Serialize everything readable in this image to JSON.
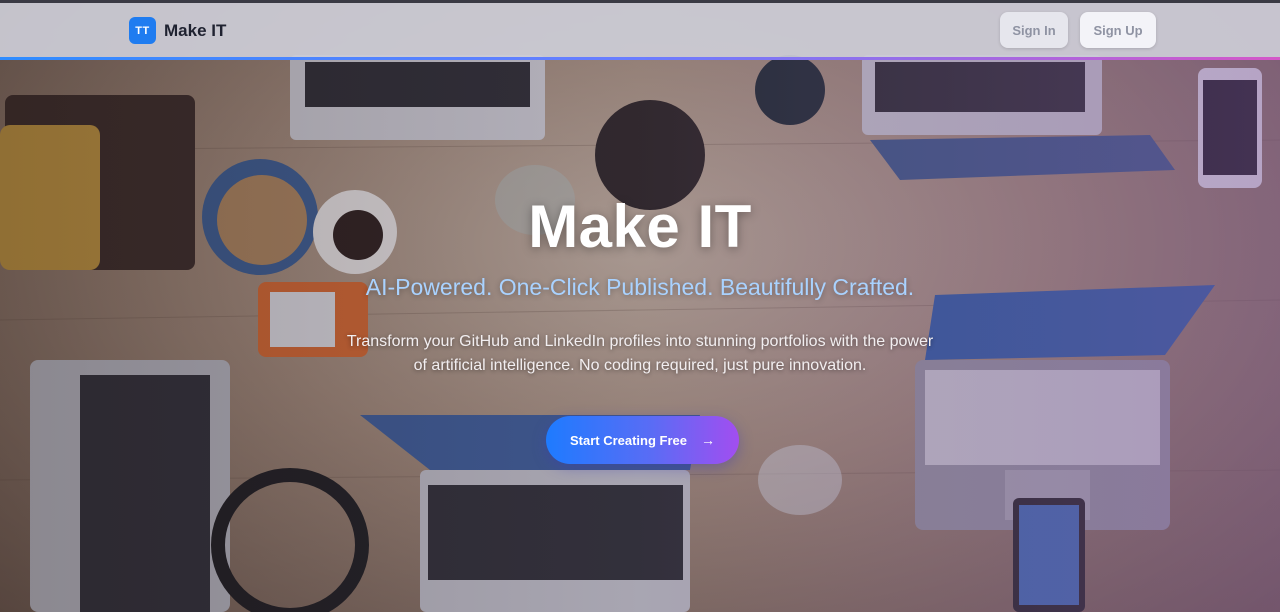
{
  "header": {
    "logo_text": "TT",
    "brand": "Make IT",
    "sign_in": "Sign In",
    "sign_up": "Sign Up"
  },
  "hero": {
    "title": "Make IT",
    "subtitle": "AI-Powered. One-Click Published. Beautifully Crafted.",
    "description": "Transform your GitHub and LinkedIn profiles into stunning portfolios with the power of artificial intelligence. No coding required, just pure innovation.",
    "cta_label": "Start Creating Free",
    "cta_icon": "arrow-right-icon"
  },
  "colors": {
    "accent_blue": "#1f7cf0",
    "subtitle": "#a9d2ff",
    "cta_start": "#1e7bff",
    "cta_end": "#a24ef0"
  }
}
